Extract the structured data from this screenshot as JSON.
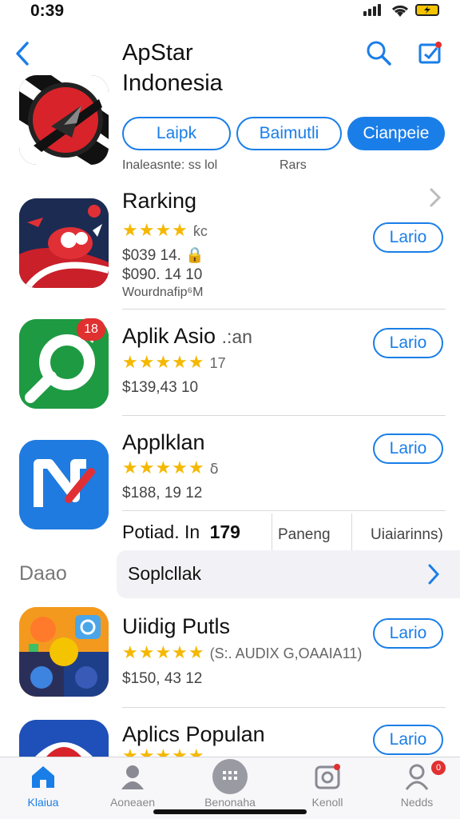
{
  "status_bar": {
    "time": "0:39"
  },
  "header": {
    "title_line1": "ApStar",
    "title_line2": "Indonesia"
  },
  "header_buttons": [
    "Laipk",
    "Baimutli",
    "Cianpeie"
  ],
  "header_sub": {
    "left": "Inaleasnte: ss lol",
    "right": "Rars"
  },
  "colors": {
    "accent": "#1a7ee8",
    "star": "#f5b800",
    "badge": "#e03030"
  },
  "apps": [
    {
      "title": "Rarking",
      "stars": "★★★★",
      "rating_text": "ƙc",
      "price": "$039 14. 🔒",
      "price2": "$090. 14 10",
      "sub": "Wourdnafip⁶M",
      "button": "Lario",
      "icon": "red-bird-icon"
    },
    {
      "title": "Aplik Asio",
      "title_suffix": ".:an",
      "stars": "★★★★★",
      "rating_text": "17",
      "price": "$139,43 10",
      "button": "Lario",
      "icon": "green-loop-icon",
      "badge": "18"
    },
    {
      "title": "Applklan",
      "stars": "★★★★★",
      "rating_text": "ẟ",
      "price": "$188, 19 12",
      "button": "Lario",
      "icon": "blue-n-icon"
    },
    {
      "title": "Uiidig Putls",
      "stars": "★★★★★",
      "rating_text": "(S:. AUDIX G,OAAIA11)",
      "price": "$150, 43 12",
      "button": "Lario",
      "icon": "game-bubbles-icon"
    },
    {
      "title": "Aplics Populan",
      "stars": "★★★★★",
      "button": "Lario",
      "icon": "eagle-icon"
    }
  ],
  "info_row": {
    "left": "Potiad. In",
    "value": "179",
    "middle": "Paneng",
    "right": "Uiaiarinns)"
  },
  "section": {
    "label": "Daao",
    "link": "Soplcllak"
  },
  "tabs": [
    {
      "label": "Klaiua",
      "icon": "home-icon"
    },
    {
      "label": "Aoneaen",
      "icon": "person-icon"
    },
    {
      "label": "Benonaha",
      "icon": "grid-icon"
    },
    {
      "label": "Kenoll",
      "icon": "camera-icon"
    },
    {
      "label": "Nedds",
      "icon": "account-icon",
      "badge": "0"
    }
  ]
}
